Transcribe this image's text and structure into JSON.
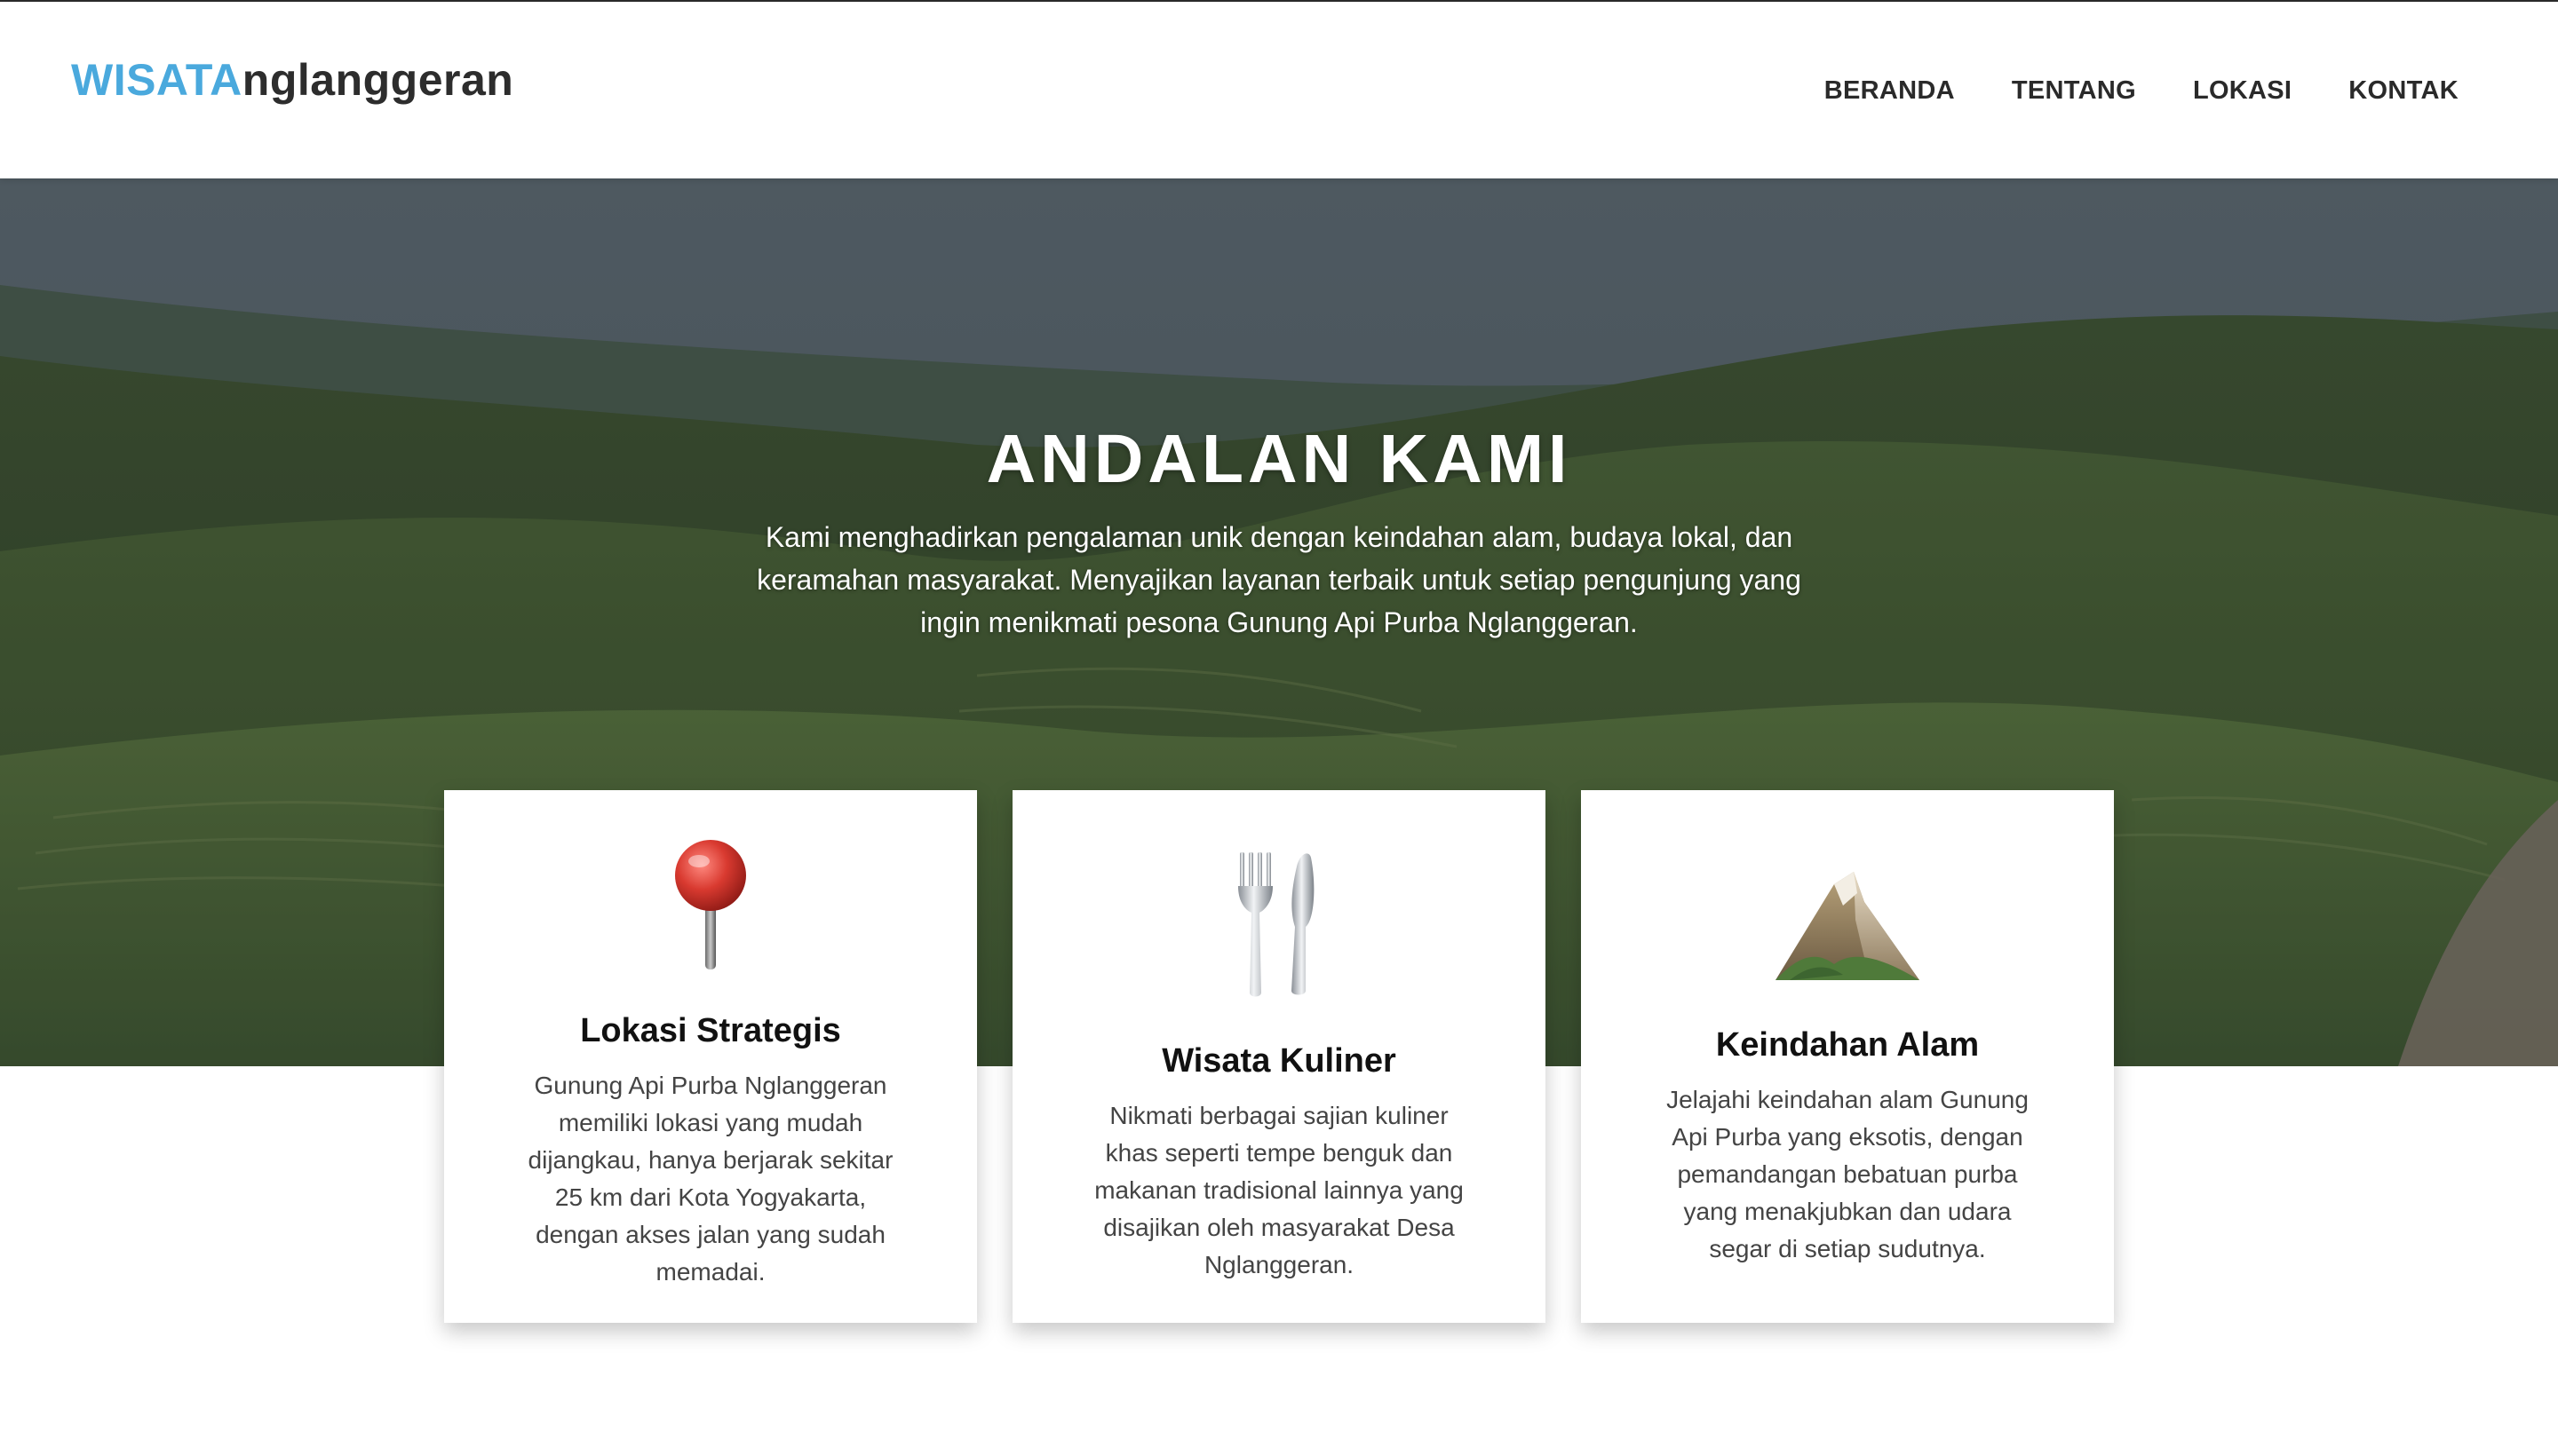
{
  "brand": {
    "part1": "WISATA",
    "part2": "nglanggeran",
    "accent_color": "#4aa9dd"
  },
  "nav": {
    "items": [
      "BERANDA",
      "TENTANG",
      "LOKASI",
      "KONTAK"
    ]
  },
  "hero": {
    "title": "ANDALAN KAMI",
    "description": "Kami menghadirkan pengalaman unik dengan keindahan alam, budaya lokal, dan keramahan masyarakat. Menyajikan layanan terbaik untuk setiap pengunjung yang ingin menikmati pesona Gunung Api Purba Nglanggeran."
  },
  "features": [
    {
      "icon": "round-pushpin-icon",
      "title": "Lokasi Strategis",
      "text": "Gunung Api Purba Nglanggeran memiliki lokasi yang mudah dijangkau, hanya berjarak sekitar 25 km dari Kota Yogyakarta, dengan akses jalan yang sudah memadai."
    },
    {
      "icon": "fork-and-knife-icon",
      "title": "Wisata Kuliner",
      "text": "Nikmati berbagai sajian kuliner khas seperti tempe benguk dan makanan tradisional lainnya yang disajikan oleh masyarakat Desa Nglanggeran."
    },
    {
      "icon": "mountain-icon",
      "title": "Keindahan Alam",
      "text": "Jelajahi keindahan alam Gunung Api Purba yang eksotis, dengan pemandangan bebatuan purba yang menakjubkan dan udara segar di setiap sudutnya."
    }
  ]
}
